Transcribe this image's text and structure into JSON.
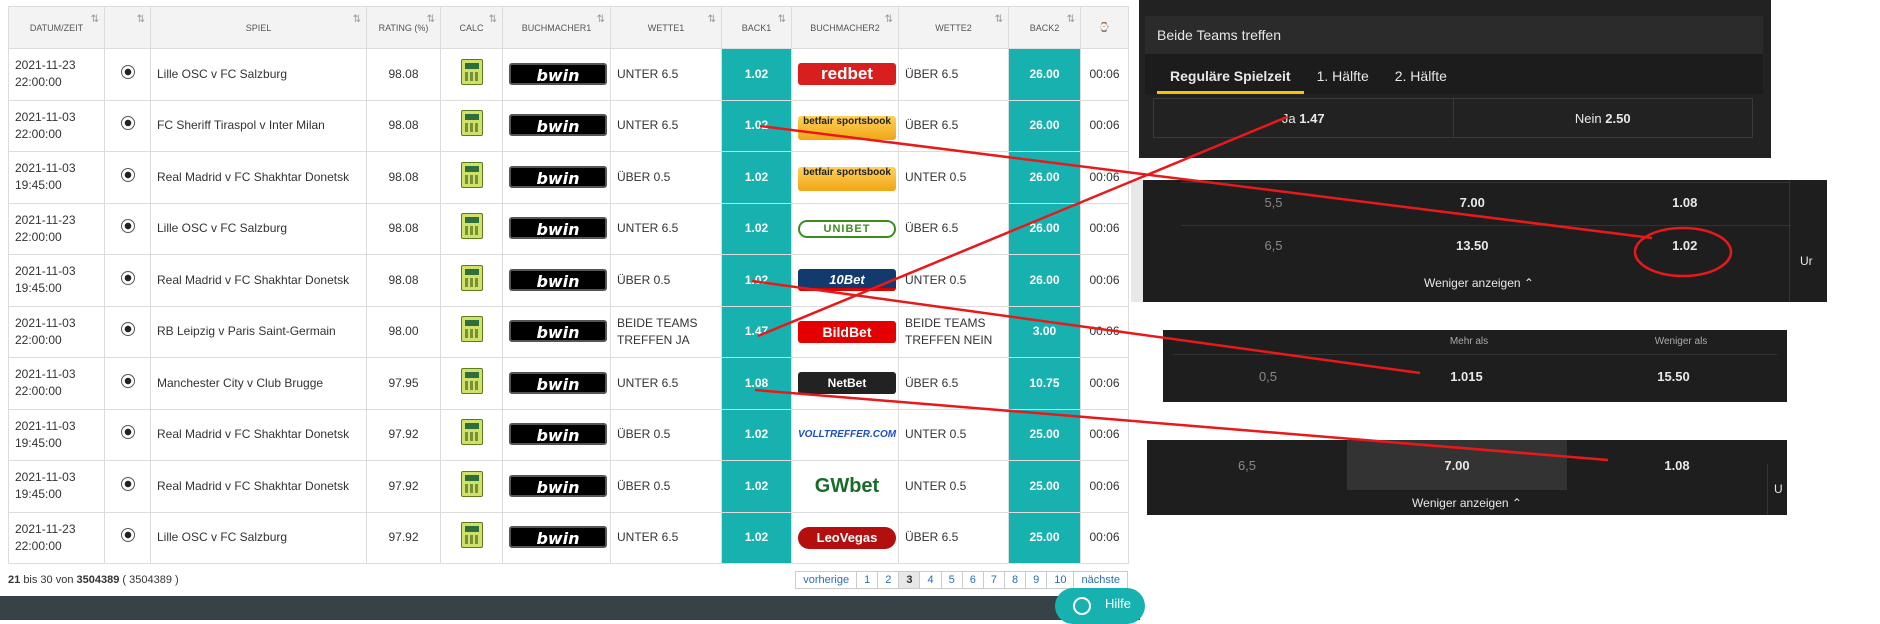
{
  "table": {
    "headers": [
      "DATUM/ZEIT",
      "",
      "SPIEL",
      "RATING (%)",
      "CALC",
      "BUCHMACHER1",
      "WETTE1",
      "BACK1",
      "BUCHMACHER2",
      "WETTE2",
      "BACK2",
      "⌚"
    ],
    "rows": [
      {
        "date": "2021-11-23",
        "time": "22:00:00",
        "game": "Lille OSC v FC Salzburg",
        "rating": "98.08",
        "bm1": "bwin",
        "bet1": "UNTER 6.5",
        "back1": "1.02",
        "bm2": "redbet",
        "bet2": "ÜBER 6.5",
        "back2": "26.00",
        "clock": "00:06"
      },
      {
        "date": "2021-11-03",
        "time": "22:00:00",
        "game": "FC Sheriff Tiraspol v Inter Milan",
        "rating": "98.08",
        "bm1": "bwin",
        "bet1": "UNTER 6.5",
        "back1": "1.02",
        "bm2": "betfair sportsbook",
        "bet2": "ÜBER 6.5",
        "back2": "26.00",
        "clock": "00:06"
      },
      {
        "date": "2021-11-03",
        "time": "19:45:00",
        "game": "Real Madrid v FC Shakhtar Donetsk",
        "rating": "98.08",
        "bm1": "bwin",
        "bet1": "ÜBER 0.5",
        "back1": "1.02",
        "bm2": "betfair sportsbook",
        "bet2": "UNTER 0.5",
        "back2": "26.00",
        "clock": "00:06"
      },
      {
        "date": "2021-11-23",
        "time": "22:00:00",
        "game": "Lille OSC v FC Salzburg",
        "rating": "98.08",
        "bm1": "bwin",
        "bet1": "UNTER 6.5",
        "back1": "1.02",
        "bm2": "UNIBET",
        "bet2": "ÜBER 6.5",
        "back2": "26.00",
        "clock": "00:06"
      },
      {
        "date": "2021-11-03",
        "time": "19:45:00",
        "game": "Real Madrid v FC Shakhtar Donetsk",
        "rating": "98.08",
        "bm1": "bwin",
        "bet1": "ÜBER 0.5",
        "back1": "1.02",
        "bm2": "10Bet",
        "bet2": "UNTER 0.5",
        "back2": "26.00",
        "clock": "00:06"
      },
      {
        "date": "2021-11-03",
        "time": "22:00:00",
        "game": "RB Leipzig v Paris Saint-Germain",
        "rating": "98.00",
        "bm1": "bwin",
        "bet1": "BEIDE TEAMS TREFFEN JA",
        "back1": "1.47",
        "bm2": "BildBet",
        "bet2": "BEIDE TEAMS TREFFEN NEIN",
        "back2": "3.00",
        "clock": "00:06"
      },
      {
        "date": "2021-11-03",
        "time": "22:00:00",
        "game": "Manchester City v Club Brugge",
        "rating": "97.95",
        "bm1": "bwin",
        "bet1": "UNTER 6.5",
        "back1": "1.08",
        "bm2": "NetBet",
        "bet2": "ÜBER 6.5",
        "back2": "10.75",
        "clock": "00:06"
      },
      {
        "date": "2021-11-03",
        "time": "19:45:00",
        "game": "Real Madrid v FC Shakhtar Donetsk",
        "rating": "97.92",
        "bm1": "bwin",
        "bet1": "ÜBER 0.5",
        "back1": "1.02",
        "bm2": "VOLLTREFFER.COM",
        "bet2": "UNTER 0.5",
        "back2": "25.00",
        "clock": "00:06"
      },
      {
        "date": "2021-11-03",
        "time": "19:45:00",
        "game": "Real Madrid v FC Shakhtar Donetsk",
        "rating": "97.92",
        "bm1": "bwin",
        "bet1": "ÜBER 0.5",
        "back1": "1.02",
        "bm2": "GWbet",
        "bet2": "UNTER 0.5",
        "back2": "25.00",
        "clock": "00:06"
      },
      {
        "date": "2021-11-23",
        "time": "22:00:00",
        "game": "Lille OSC v FC Salzburg",
        "rating": "97.92",
        "bm1": "bwin",
        "bet1": "UNTER 6.5",
        "back1": "1.02",
        "bm2": "LeoVegas",
        "bet2": "ÜBER 6.5",
        "back2": "25.00",
        "clock": "00:06"
      }
    ]
  },
  "footer": {
    "range_from": "21",
    "range_text": "bis 30 von",
    "total": "3504389",
    "total_paren": "( 3504389 )",
    "pages": [
      "vorherige",
      "1",
      "2",
      "3",
      "4",
      "5",
      "6",
      "7",
      "8",
      "9",
      "10",
      "nächste"
    ],
    "active_page": "3"
  },
  "help_label": "Hilfe",
  "panel_btts": {
    "title": "Beide Teams treffen",
    "tabs": [
      "Reguläre Spielzeit",
      "1. Hälfte",
      "2. Hälfte"
    ],
    "yes_label": "Ja",
    "yes_odds": "1.47",
    "no_label": "Nein",
    "no_odds": "2.50"
  },
  "panel_goals": {
    "rows": [
      {
        "line": "5,5",
        "over": "7.00",
        "under": "1.08"
      },
      {
        "line": "6,5",
        "over": "13.50",
        "under": "1.02"
      }
    ],
    "less_label": "Weniger anzeigen ⌃",
    "edge_text": "Ur"
  },
  "panel_overunder": {
    "head_over": "Mehr als",
    "head_under": "Weniger als",
    "line": "0,5",
    "over": "1.015",
    "under": "15.50"
  },
  "panel_goals2": {
    "line": "6,5",
    "over": "7.00",
    "under": "1.08",
    "less_label": "Weniger anzeigen ⌃",
    "edge_text": "U"
  },
  "colors": {
    "back_cell": "#17b2b0",
    "annotation": "#e8191a",
    "panel_bg": "#222222",
    "tab_accent": "#f6c400"
  }
}
